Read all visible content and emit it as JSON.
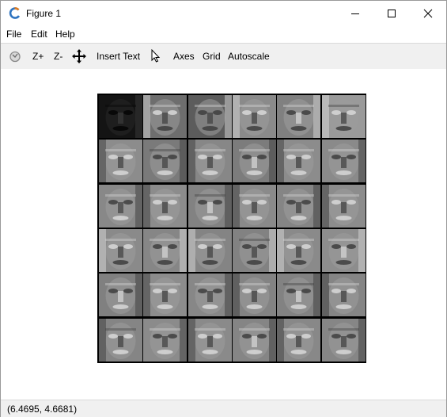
{
  "window": {
    "title": "Figure 1"
  },
  "menu": [
    "File",
    "Edit",
    "Help"
  ],
  "toolbar": {
    "zoom_in": "Z+",
    "zoom_out": "Z-",
    "insert_text": "Insert Text",
    "axes": "Axes",
    "grid": "Grid",
    "autoscale": "Autoscale"
  },
  "icons": [
    "app-icon",
    "minimize-icon",
    "maximize-icon",
    "close-icon",
    "rotate-icon",
    "pan-icon",
    "cursor-arrow-icon"
  ],
  "figure": {
    "rows": 6,
    "cols": 6,
    "tile_tones": [
      [
        "#141414",
        "#6e6e6e",
        "#5c5c5c",
        "#8a8a8a",
        "#808080",
        "#9a9a9a"
      ],
      [
        "#8c8c8c",
        "#7a7a7a",
        "#878787",
        "#7c7c7c",
        "#8c8c8c",
        "#8a8a8a"
      ],
      [
        "#888888",
        "#8c8c8c",
        "#828282",
        "#8a8a8a",
        "#858585",
        "#8c8c8c"
      ],
      [
        "#8a8a8a",
        "#868686",
        "#848484",
        "#828282",
        "#8a8a8a",
        "#8d8d8d"
      ],
      [
        "#808080",
        "#8c8c8c",
        "#878787",
        "#838383",
        "#828282",
        "#858585"
      ],
      [
        "#858585",
        "#8b8b8b",
        "#8a8a8a",
        "#858585",
        "#888888",
        "#868686"
      ]
    ]
  },
  "status": {
    "coords": "(6.4695, 4.6681)"
  }
}
